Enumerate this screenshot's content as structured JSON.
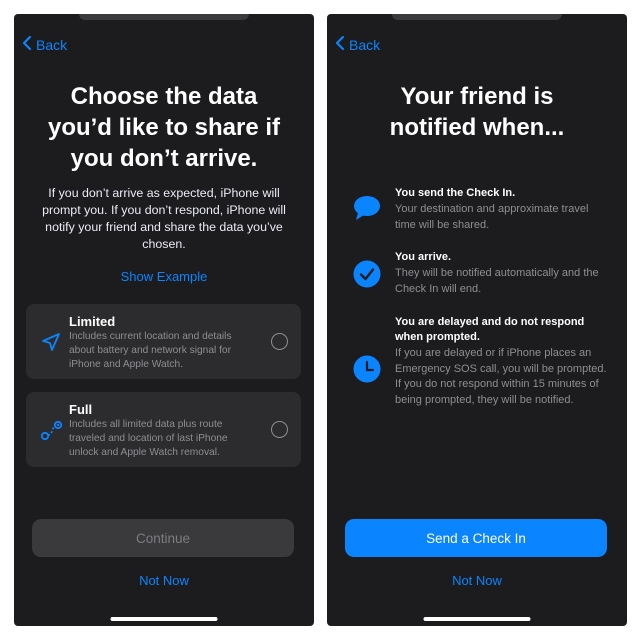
{
  "colors": {
    "accent": "#0a84ff",
    "background": "#1c1c1e",
    "card": "#2c2c2e"
  },
  "left": {
    "back_label": "Back",
    "title_lines": [
      "Choose the data",
      "you’d like to share if",
      "you don’t arrive."
    ],
    "description": "If you don’t arrive as expected, iPhone will prompt you. If you don’t respond, iPhone will notify your friend and share the data you’ve chosen.",
    "show_example": "Show Example",
    "options": [
      {
        "title": "Limited",
        "icon": "location-arrow-icon",
        "description": "Includes current location and details about battery and network signal for iPhone and Apple Watch.",
        "selected": false
      },
      {
        "title": "Full",
        "icon": "route-icon",
        "description": "Includes all limited data plus route traveled and location of last iPhone unlock and Apple Watch removal.",
        "selected": false
      }
    ],
    "continue_label": "Continue",
    "not_now_label": "Not Now"
  },
  "right": {
    "back_label": "Back",
    "title_lines": [
      "Your friend is",
      "notified when..."
    ],
    "items": [
      {
        "icon": "message-bubble-icon",
        "title": "You send the Check In.",
        "description": "Your destination and approximate travel time will be shared."
      },
      {
        "icon": "checkmark-circle-icon",
        "title": "You arrive.",
        "description": "They will be notified automatically and the Check In will end."
      },
      {
        "icon": "clock-icon",
        "title": "You are delayed and do not respond when prompted.",
        "description": "If you are delayed or if iPhone places an Emergency SOS call, you will be prompted. If you do not respond within 15 minutes of being prompted, they will be notified."
      }
    ],
    "send_label": "Send a Check In",
    "not_now_label": "Not Now"
  }
}
